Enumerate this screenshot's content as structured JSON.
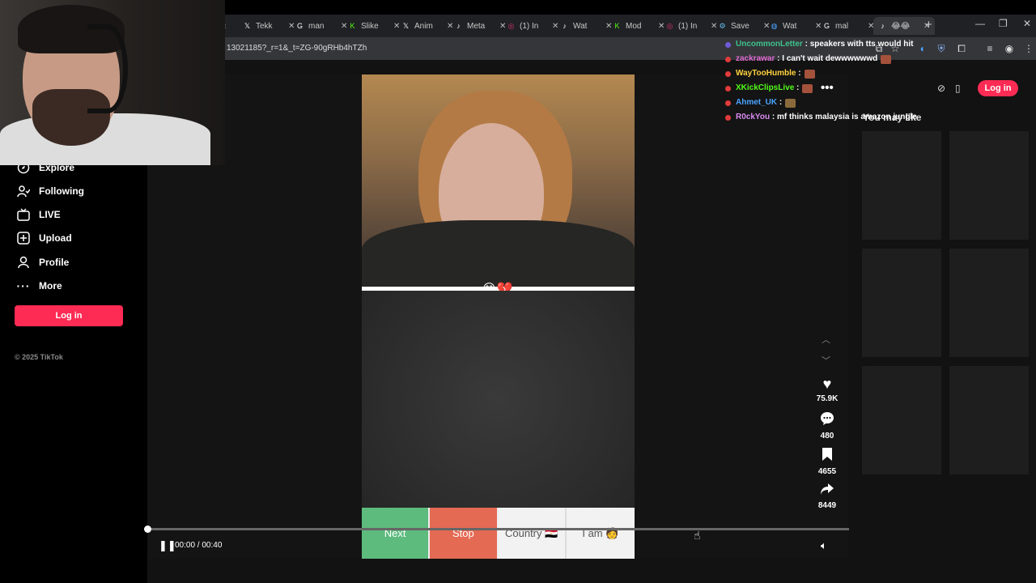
{
  "browser": {
    "tabs": [
      {
        "label": "Tekk",
        "icon": "x-logo-icon",
        "color": "#ffffff"
      },
      {
        "label": "man",
        "icon": "google-icon",
        "color": "#ffffff"
      },
      {
        "label": "Slike",
        "icon": "kick-icon",
        "color": "#53fc18"
      },
      {
        "label": "Anim",
        "icon": "x-logo-icon",
        "color": "#ffffff"
      },
      {
        "label": "Meta",
        "icon": "tiktok-icon",
        "color": "#ffffff"
      },
      {
        "label": "(1) In",
        "icon": "instagram-icon",
        "color": "#e1306c"
      },
      {
        "label": "Wat",
        "icon": "tiktok-icon",
        "color": "#ffffff"
      },
      {
        "label": "Mod",
        "icon": "kick-icon",
        "color": "#53fc18"
      },
      {
        "label": "(1) In",
        "icon": "instagram-icon",
        "color": "#e1306c"
      },
      {
        "label": "Save",
        "icon": "steam-icon",
        "color": "#66c0f4"
      },
      {
        "label": "Wat",
        "icon": "copilot-icon",
        "color": "#4aa3ff"
      },
      {
        "label": "mal",
        "icon": "google-icon",
        "color": "#ffffff"
      },
      {
        "label": "😂😂",
        "icon": "tiktok-icon",
        "color": "#ffffff",
        "active": true
      }
    ],
    "url": "13021185?_r=1&_t=ZG-90gRHb4hTZh",
    "newtab": "+",
    "leftarrow": "‹"
  },
  "sidebar": {
    "items": [
      {
        "label": "Explore",
        "icon": "compass-icon"
      },
      {
        "label": "Following",
        "icon": "following-icon"
      },
      {
        "label": "LIVE",
        "icon": "live-icon"
      },
      {
        "label": "Upload",
        "icon": "upload-icon"
      },
      {
        "label": "Profile",
        "icon": "profile-icon"
      },
      {
        "label": "More",
        "icon": "more-icon"
      }
    ],
    "login": "Log in",
    "copyright": "© 2025 TikTok"
  },
  "header": {
    "login": "Log in"
  },
  "video": {
    "divider_emoji": "😂💔",
    "buttons": {
      "next": "Next",
      "stop": "Stop",
      "country": "Country",
      "country_flag": "🇪🇬",
      "iam": "I am",
      "iam_emoji": "🧑"
    },
    "time": "00:00 / 00:40",
    "progress": 0.0
  },
  "actions": {
    "likes": "75.9K",
    "comments": "480",
    "saves": "4655",
    "shares": "8449"
  },
  "right": {
    "you_may_like": "You may like"
  },
  "chat": [
    {
      "user": "UncommonLetter",
      "color": "#3ec28d",
      "badge": "#6f5bd6",
      "text": "speakers with tts would hit",
      "emote": false
    },
    {
      "user": "zackrawar",
      "color": "#e06cd6",
      "badge": "#e23b3b",
      "text": "I can't wait dewwwwwwd",
      "emote": true
    },
    {
      "user": "WayTooHumble",
      "color": "#ffd23e",
      "badge": "#e23b3b",
      "text": "",
      "emote": true
    },
    {
      "user": "XKickClipsLive",
      "color": "#53fc18",
      "badge": "#e23b3b",
      "text": "",
      "emote": true
    },
    {
      "user": "Ahmet_UK",
      "color": "#4aa3ff",
      "badge": "#e23b3b",
      "text": "",
      "emote": true
    },
    {
      "user": "R0ckYou",
      "color": "#d98cf0",
      "badge": "#e23b3b",
      "text": "mf thinks malaysia is amazon jungle",
      "emote": false
    }
  ]
}
